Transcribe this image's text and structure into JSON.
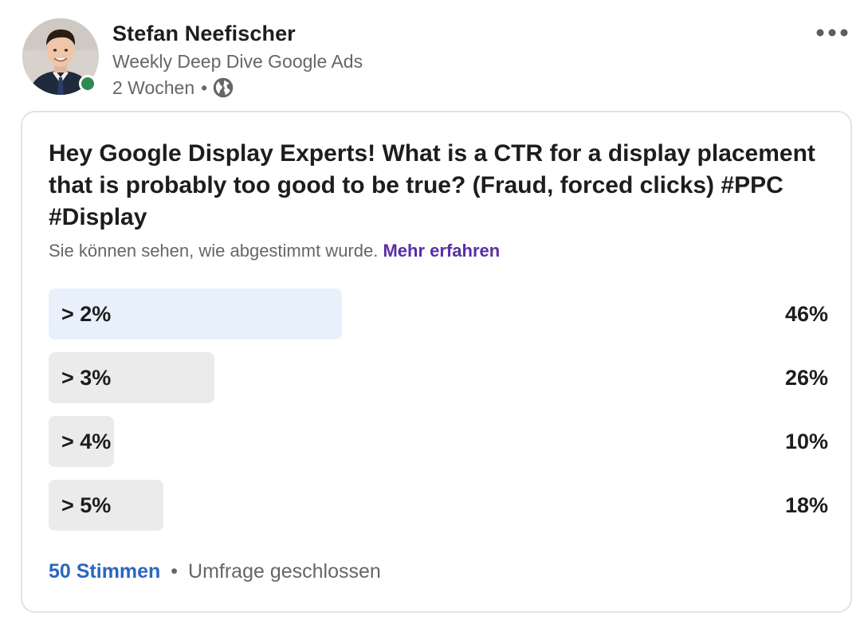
{
  "author": {
    "name": "Stefan Neefischer",
    "headline": "Weekly Deep Dive Google Ads",
    "time": "2 Wochen",
    "separator": "•",
    "visibility_icon": "globe-icon",
    "presence_color": "#2e8b4f"
  },
  "menu": {
    "icon": "more-horizontal-icon"
  },
  "poll": {
    "question": "Hey Google Display Experts! What is a CTR for a display placement that is probably too good to be true? (Fraud, forced clicks) #PPC #Display",
    "visibility_text": "Sie können sehen, wie abgestimmt wurde.",
    "learn_more": "Mehr erfahren",
    "options": [
      {
        "label": "> 2%",
        "percent": "46%",
        "share": 0.46,
        "selected": true
      },
      {
        "label": "> 3%",
        "percent": "26%",
        "share": 0.26,
        "selected": false
      },
      {
        "label": "> 4%",
        "percent": "10%",
        "share": 0.1,
        "selected": false
      },
      {
        "label": "> 5%",
        "percent": "18%",
        "share": 0.18,
        "selected": false
      }
    ],
    "votes": "50 Stimmen",
    "footer_separator": "•",
    "status": "Umfrage geschlossen"
  },
  "colors": {
    "link_blue": "#2a66c2",
    "link_purple": "#5a2ea6",
    "selected_bar": "#e8f0fc",
    "bar": "#ebebeb",
    "secondary_text": "#666666"
  }
}
